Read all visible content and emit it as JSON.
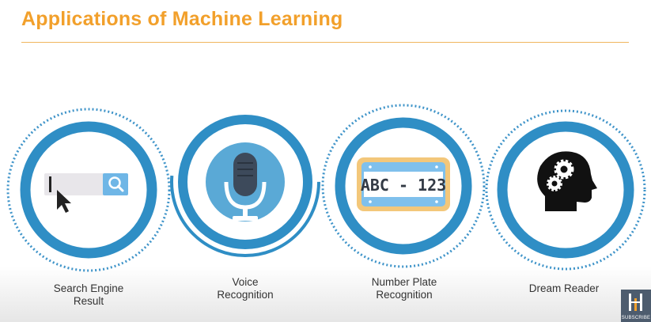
{
  "title": "Applications of Machine Learning",
  "items": [
    {
      "label_lines": [
        "Search Engine",
        "Result"
      ],
      "icon": "search-bar-icon"
    },
    {
      "label_lines": [
        "Voice",
        "Recognition"
      ],
      "icon": "microphone-icon"
    },
    {
      "label_lines": [
        "Number Plate",
        "Recognition"
      ],
      "icon": "number-plate-icon",
      "plate_text": "ABC - 123"
    },
    {
      "label_lines": [
        "Dream Reader"
      ],
      "icon": "head-gears-icon"
    }
  ],
  "subscribe_label": "SUBSCRIBE",
  "colors": {
    "title": "#f2a02b",
    "ring": "#2f8ec5",
    "ring_light": "#5aa9d6",
    "dots": "#3f94c9",
    "plate_frame": "#f3c77a"
  }
}
